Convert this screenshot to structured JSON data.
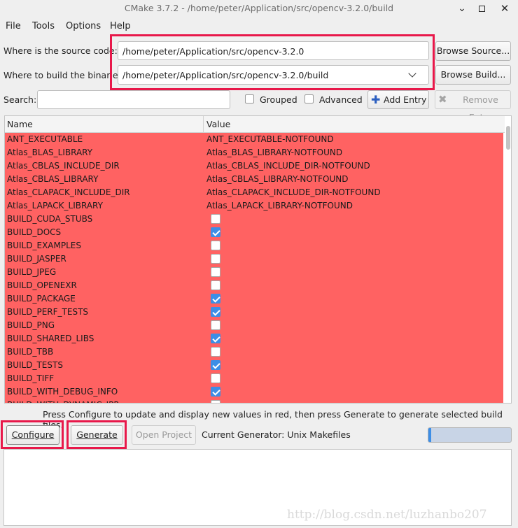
{
  "window": {
    "title": "CMake 3.7.2 - /home/peter/Application/src/opencv-3.2.0/build",
    "minimize_icon": "minimize-icon",
    "maximize_icon": "maximize-icon",
    "close_icon": "close-icon"
  },
  "menu": [
    {
      "label": "File"
    },
    {
      "label": "Tools"
    },
    {
      "label": "Options"
    },
    {
      "label": "Help"
    }
  ],
  "source": {
    "label": "Where is the source code:",
    "value": "/home/peter/Application/src/opencv-3.2.0",
    "browse_label": "Browse Source..."
  },
  "build": {
    "label": "Where to build the binaries:",
    "value": "/home/peter/Application/src/opencv-3.2.0/build",
    "browse_label": "Browse Build..."
  },
  "search": {
    "label": "Search:",
    "value": ""
  },
  "options": {
    "grouped_label": "Grouped",
    "grouped_checked": false,
    "advanced_label": "Advanced",
    "advanced_checked": false,
    "add_entry_label": "Add Entry",
    "remove_entry_label": "Remove Entry"
  },
  "table": {
    "col_name": "Name",
    "col_value": "Value",
    "row_color": "#ff6262",
    "rows": [
      {
        "name": "ANT_EXECUTABLE",
        "value": "ANT_EXECUTABLE-NOTFOUND"
      },
      {
        "name": "Atlas_BLAS_LIBRARY",
        "value": "Atlas_BLAS_LIBRARY-NOTFOUND"
      },
      {
        "name": "Atlas_CBLAS_INCLUDE_DIR",
        "value": "Atlas_CBLAS_INCLUDE_DIR-NOTFOUND"
      },
      {
        "name": "Atlas_CBLAS_LIBRARY",
        "value": "Atlas_CBLAS_LIBRARY-NOTFOUND"
      },
      {
        "name": "Atlas_CLAPACK_INCLUDE_DIR",
        "value": "Atlas_CLAPACK_INCLUDE_DIR-NOTFOUND"
      },
      {
        "name": "Atlas_LAPACK_LIBRARY",
        "value": "Atlas_LAPACK_LIBRARY-NOTFOUND"
      },
      {
        "name": "BUILD_CUDA_STUBS",
        "checked": false
      },
      {
        "name": "BUILD_DOCS",
        "checked": true
      },
      {
        "name": "BUILD_EXAMPLES",
        "checked": false
      },
      {
        "name": "BUILD_JASPER",
        "checked": false
      },
      {
        "name": "BUILD_JPEG",
        "checked": false
      },
      {
        "name": "BUILD_OPENEXR",
        "checked": false
      },
      {
        "name": "BUILD_PACKAGE",
        "checked": true
      },
      {
        "name": "BUILD_PERF_TESTS",
        "checked": true
      },
      {
        "name": "BUILD_PNG",
        "checked": false
      },
      {
        "name": "BUILD_SHARED_LIBS",
        "checked": true
      },
      {
        "name": "BUILD_TBB",
        "checked": false
      },
      {
        "name": "BUILD_TESTS",
        "checked": true
      },
      {
        "name": "BUILD_TIFF",
        "checked": false
      },
      {
        "name": "BUILD_WITH_DEBUG_INFO",
        "checked": true
      },
      {
        "name": "BUILD_WITH_DYNAMIC_IPP",
        "checked": false
      }
    ]
  },
  "hint": "Press Configure to update and display new values in red, then press Generate to generate selected build files.",
  "actions": {
    "configure_label": "Configure",
    "generate_label": "Generate",
    "open_project_label": "Open Project",
    "generator_text": "Current Generator: Unix Makefiles",
    "progress": 0.0
  },
  "watermark": "http://blog.csdn.net/luzhanbo207"
}
